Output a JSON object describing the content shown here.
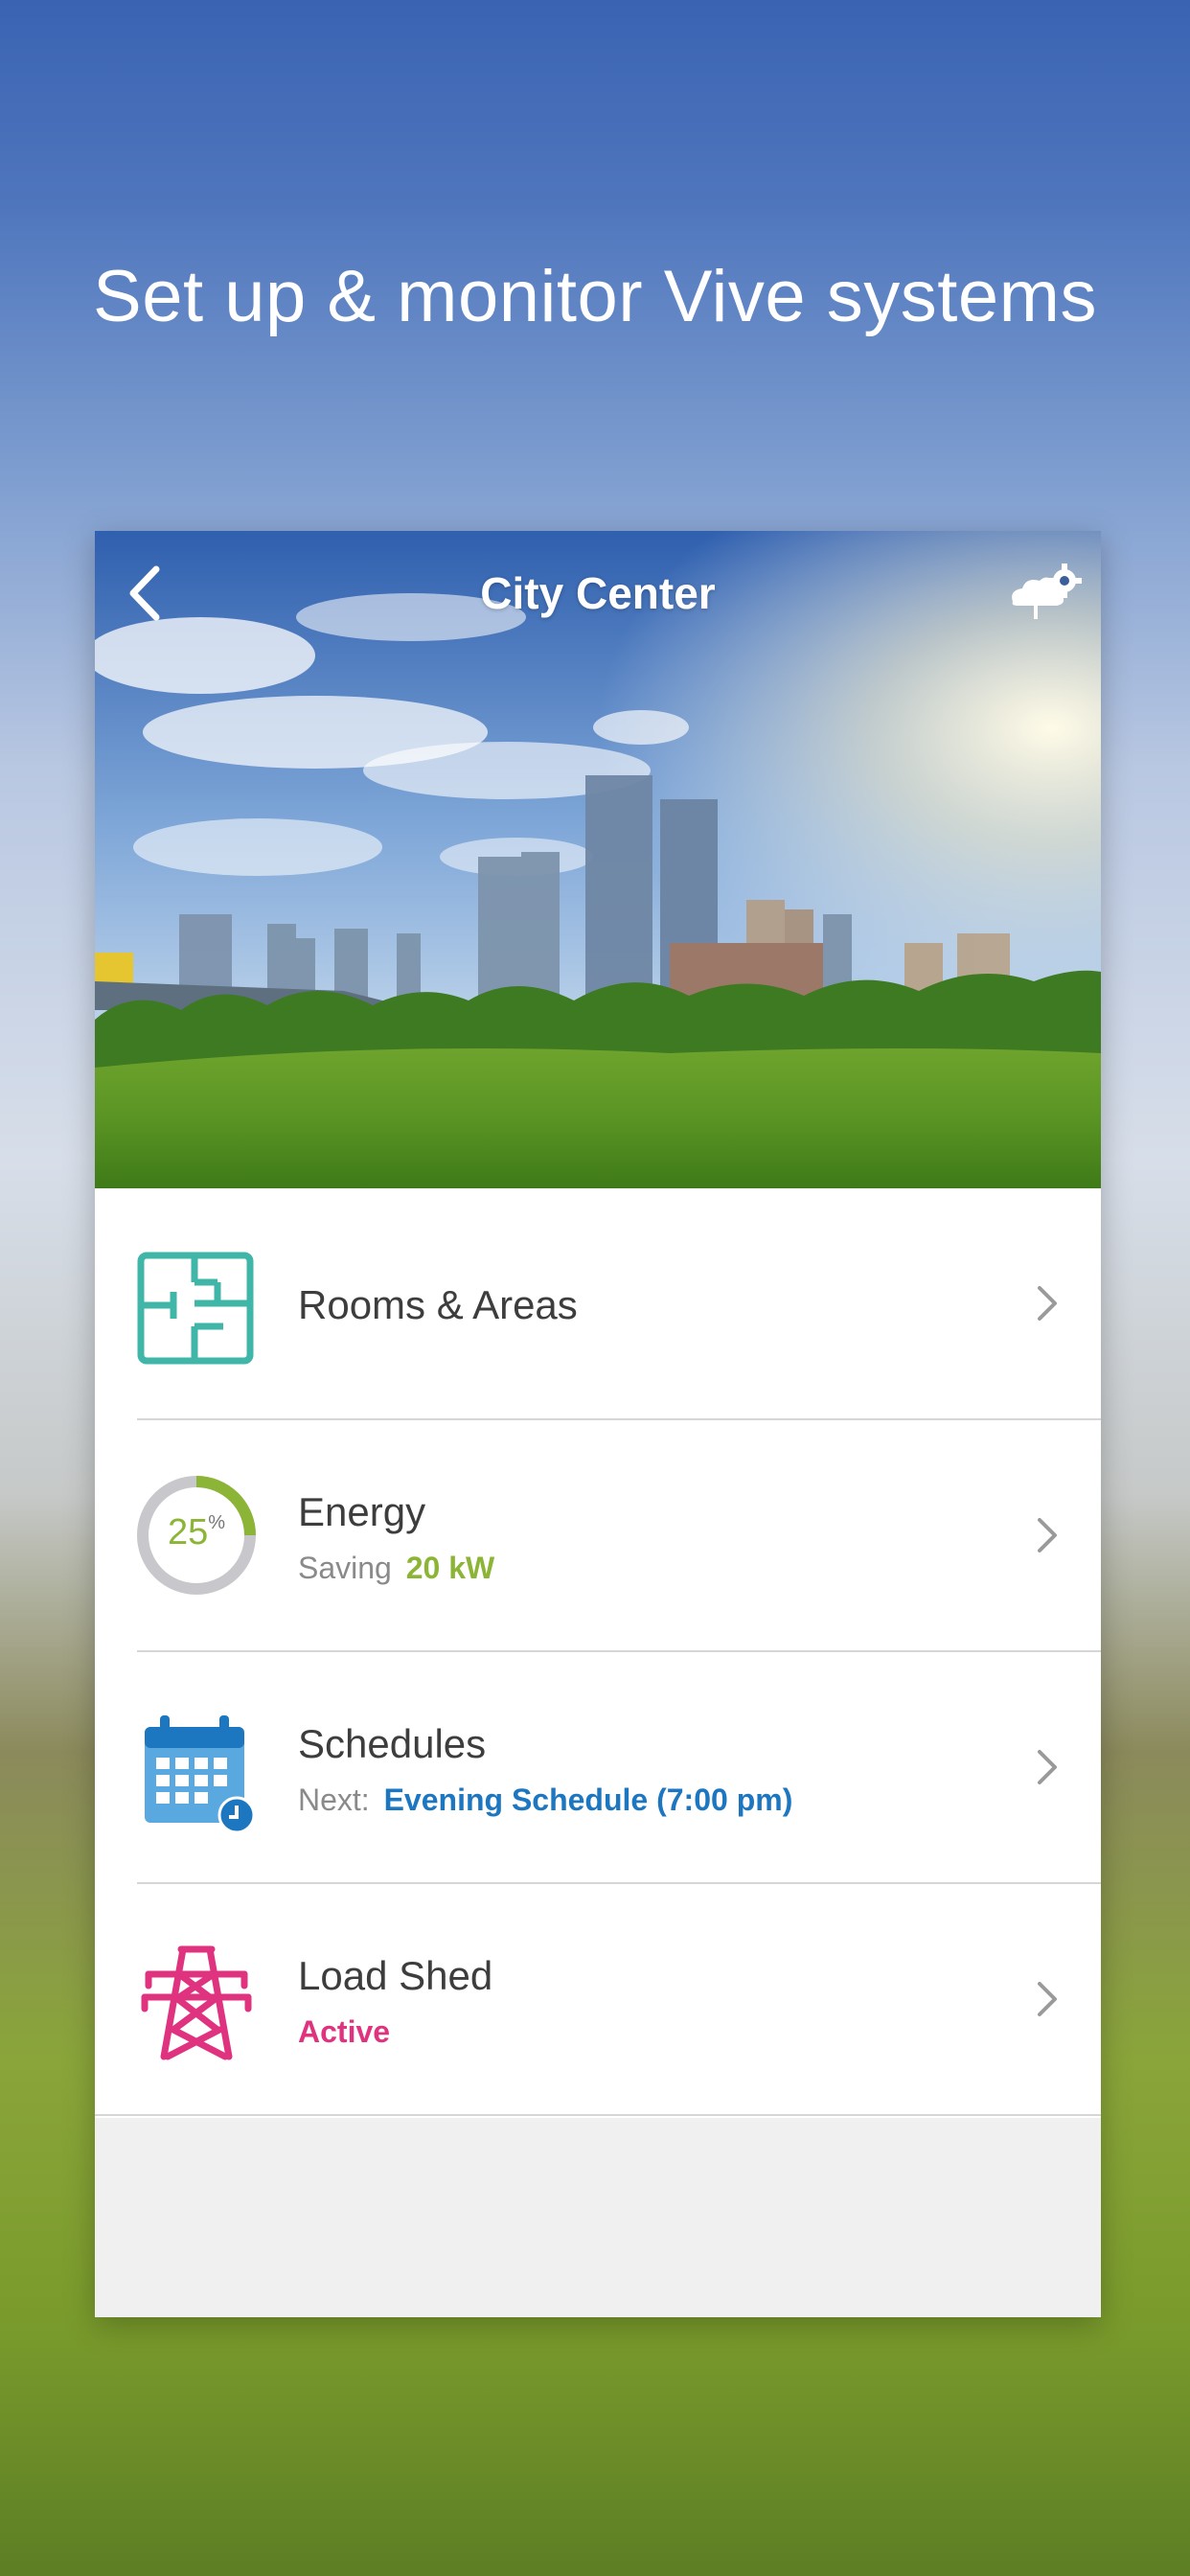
{
  "headline": "Set up & monitor Vive systems",
  "header": {
    "title": "City Center",
    "back_icon": "chevron-left-icon",
    "settings_icon": "cloud-gear-icon"
  },
  "menu": [
    {
      "title": "Rooms & Areas",
      "icon": "floorplan-icon"
    },
    {
      "title": "Energy",
      "sub_label": "Saving",
      "sub_value": "20 kW",
      "icon": "energy-gauge-icon",
      "gauge_value": "25",
      "gauge_unit": "%"
    },
    {
      "title": "Schedules",
      "sub_label": "Next:",
      "sub_value": "Evening Schedule (7:00 pm)",
      "icon": "calendar-clock-icon"
    },
    {
      "title": "Load Shed",
      "sub_value": "Active",
      "icon": "power-tower-icon"
    }
  ],
  "colors": {
    "teal": "#3fb6a8",
    "energy_green": "#8cb537",
    "schedule_blue": "#1d76c0",
    "loadshed_pink": "#e0337f"
  }
}
